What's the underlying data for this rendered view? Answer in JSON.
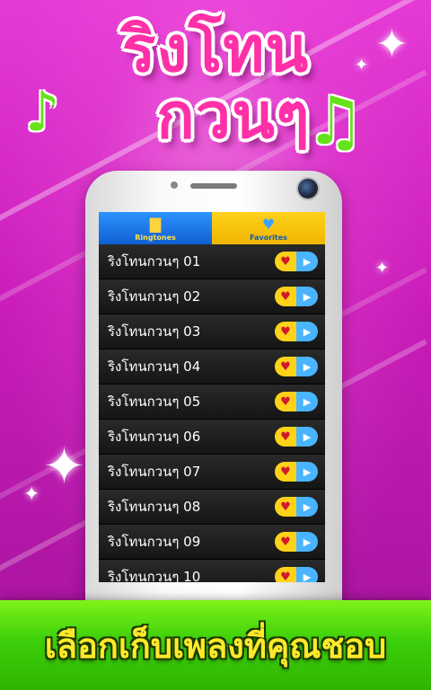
{
  "header": {
    "title_line1": "ริงโทน",
    "title_line2": "กวนๆ"
  },
  "decor": {
    "note_left_icon": "music-note-icon",
    "note_right_icon": "double-music-note-icon",
    "note_glyph_left": "♪",
    "note_glyph_right": "♫",
    "sparkle_glyph": "✦"
  },
  "tabs": [
    {
      "label": "Ringtones",
      "icon": "folder-music-icon",
      "glyph": "▇"
    },
    {
      "label": "Favorites",
      "icon": "heart-icon",
      "glyph": "♥"
    }
  ],
  "ringtones": [
    {
      "title": "ริงโทนกวนๆ 01"
    },
    {
      "title": "ริงโทนกวนๆ 02"
    },
    {
      "title": "ริงโทนกวนๆ 03"
    },
    {
      "title": "ริงโทนกวนๆ 04"
    },
    {
      "title": "ริงโทนกวนๆ 05"
    },
    {
      "title": "ริงโทนกวนๆ 06"
    },
    {
      "title": "ริงโทนกวนๆ 07"
    },
    {
      "title": "ริงโทนกวนๆ 08"
    },
    {
      "title": "ริงโทนกวนๆ 09"
    },
    {
      "title": "ริงโทนกวนๆ 10"
    }
  ],
  "row_buttons": {
    "heart_glyph": "♥",
    "play_glyph": "▶"
  },
  "banner": {
    "text": "เลือกเก็บเพลงที่คุณชอบ"
  },
  "colors": {
    "background": "#c81fb7",
    "title": "#ff2fa8",
    "note": "#66e21a",
    "tab_ringtones": "#1f7ae8",
    "tab_favorites": "#ffd21a",
    "banner": "#3ccf0a",
    "banner_text": "#ffe92a"
  }
}
